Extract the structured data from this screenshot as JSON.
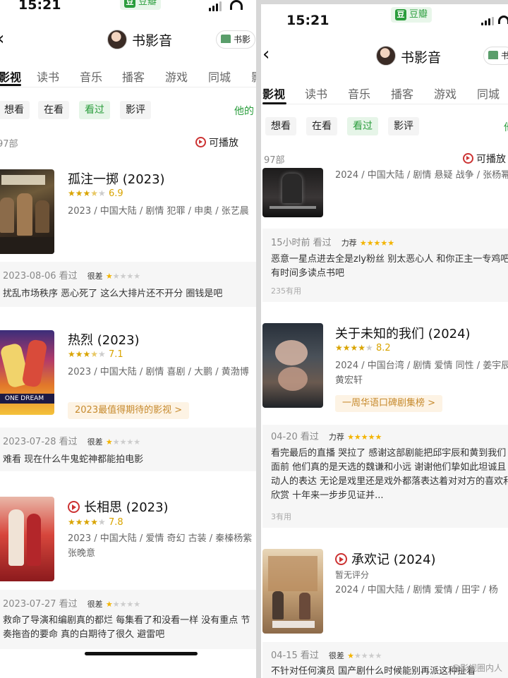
{
  "left": {
    "time": "15:21",
    "douban_label": "豆瓣",
    "title": "书影音",
    "shelf_label": "书影",
    "tabs": [
      "影视",
      "读书",
      "音乐",
      "播客",
      "游戏",
      "同城",
      "影"
    ],
    "filters": [
      "想看",
      "在看",
      "看过",
      "影评"
    ],
    "others_label": "他的",
    "count": "97部",
    "playable_label": "可播放",
    "movies": [
      {
        "title": "孤注一掷 (2023)",
        "has_play": false,
        "rating": "6.9",
        "stars": 3.5,
        "meta": "2023 / 中国大陆 / 剧情 犯罪 / 申奥 / 张艺晨",
        "review_head": "2023-08-06 看过",
        "review_level": "很差",
        "review_stars": 1,
        "review_body": "扰乱市场秩序 恶心死了 这么大排片还不开分 圈钱是吧"
      },
      {
        "title": "热烈 (2023)",
        "has_play": false,
        "rating": "7.1",
        "stars": 3.5,
        "meta": "2023 / 中国大陆 / 剧情 喜剧 / 大鹏 / 黄渤博",
        "rank": "2023最值得期待的影视 >",
        "review_head": "2023-07-28 看过",
        "review_level": "很差",
        "review_stars": 1,
        "review_body": "难看 现在什么牛鬼蛇神都能拍电影"
      },
      {
        "title": "长相思 (2023)",
        "has_play": true,
        "rating": "7.8",
        "stars": 4,
        "meta": "2023 / 中国大陆 / 爱情 奇幻 古装 / 秦榛杨紫 张晚意",
        "review_head": "2023-07-27 看过",
        "review_level": "很差",
        "review_stars": 1,
        "review_body": "救命了导演和编剧真的都烂 每集看了和没看一样 没有重点 节奏拖沓的要命 真的白期待了很久 避雷吧"
      }
    ]
  },
  "right": {
    "time": "15:21",
    "douban_label": "豆瓣",
    "title": "书影音",
    "shelf_label": "书",
    "tabs": [
      "影视",
      "读书",
      "音乐",
      "播客",
      "游戏",
      "同城"
    ],
    "filters": [
      "想看",
      "在看",
      "看过",
      "影评"
    ],
    "others_label": "他",
    "count": "97部",
    "playable_label": "可播放",
    "top_meta": "2024 / 中国大陆 / 剧情 悬疑 战争 / 张杨幂",
    "top_review": {
      "head": "15小时前 看过",
      "level": "力荐",
      "stars": 5,
      "body": "恶意一星点进去全是zly粉丝 别太恶心人 和你正主一专鸡吧 有时间多读点书吧",
      "useful": "235有用"
    },
    "movies": [
      {
        "title": "关于未知的我们 (2024)",
        "has_play": false,
        "rating": "8.2",
        "stars": 4,
        "meta": "2024 / 中国台湾 / 剧情 爱情 同性 / 姜宇辰 黄宏轩",
        "rank": "一周华语口碑剧集榜 >",
        "review_head": "04-20 看过",
        "review_level": "力荐",
        "review_stars": 5,
        "review_body": "看完最后的直播 哭拉了 感谢这部剧能把邱宇辰和黄到我们面前 他们真的是天选的魏谦和小远 谢谢他们挚如此坦诚且动人的表达 无论是戏里还是戏外都落表达着对对方的喜欢和欣赏 十年来一步步见证并...",
        "useful": "3有用"
      },
      {
        "title": "承欢记 (2024)",
        "has_play": true,
        "rating_text": "暂无评分",
        "meta": "2024 / 中国大陆 / 剧情 爱情 / 田宇 / 杨",
        "review_head": "04-15 看过",
        "review_level": "很差",
        "review_stars": 1,
        "review_body": "不针对任何演员 国产剧什么时候能别再派这种扯着"
      }
    ]
  },
  "watermark": "@影视圈内人"
}
